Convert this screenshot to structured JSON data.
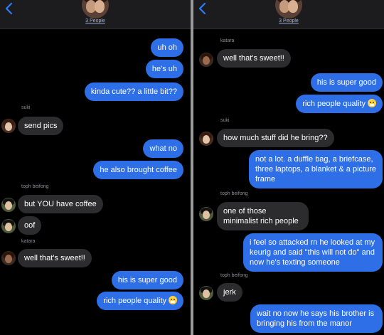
{
  "header": {
    "people_label": "3 People"
  },
  "left": {
    "messages": [
      "uh oh",
      "he's uh",
      "kinda cute?? a little bit??",
      "send pics",
      "what no",
      "he also brought coffee",
      "but YOU have coffee",
      "oof",
      "well that's sweet!!",
      "his is super good",
      "rich people quality"
    ],
    "names": [
      "suki",
      "toph beifong",
      "katara"
    ]
  },
  "right": {
    "messages": [
      "well that's sweet!!",
      "his is super good",
      "rich people quality",
      "how much stuff did he bring??",
      "not a lot. a duffle bag, a briefcase, three laptops, a blanket & a picture frame",
      "one of those minimalist rich people",
      "i feel so attacked rn he looked at my keurig and said \"this will not do\" and now he's texting someone",
      "jerk",
      "wait no now he says his brother is bringing his from the manor"
    ],
    "names": [
      "katara",
      "suki",
      "toph beifong",
      "toph beifong"
    ]
  },
  "icons": {
    "back": "chevron-left-icon",
    "emoji": "grimacing-face-emoji"
  },
  "colors": {
    "sent": "#2e6fe8",
    "received": "#2c2c2e",
    "background": "#000000"
  }
}
